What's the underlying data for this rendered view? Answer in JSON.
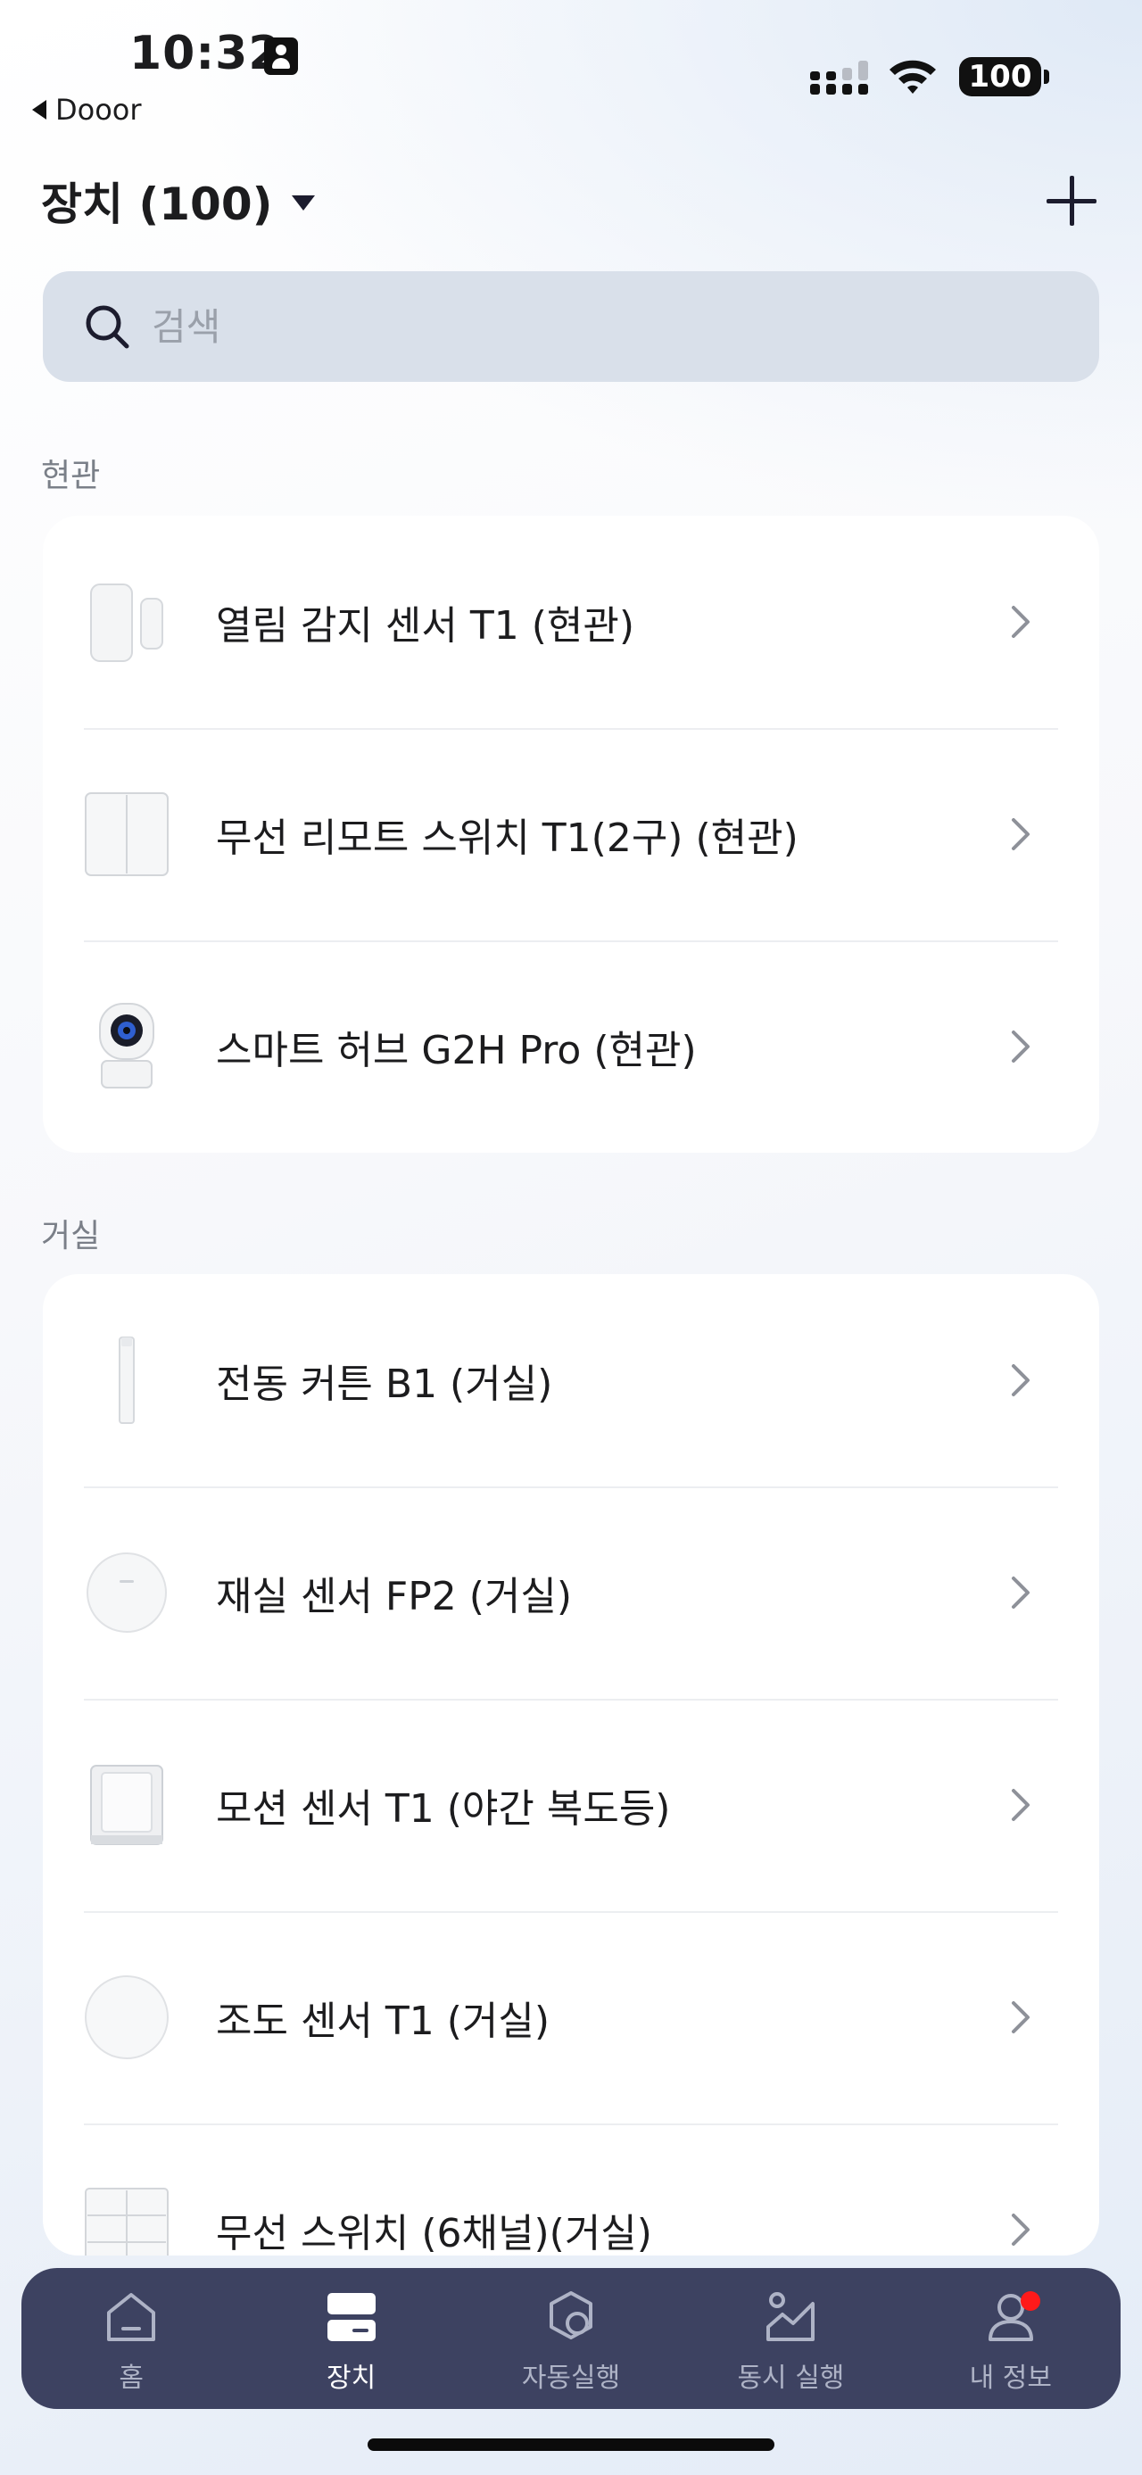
{
  "status_bar": {
    "time": "10:32",
    "back_app": "Dooor",
    "battery": "100"
  },
  "header": {
    "title": "장치 (100)"
  },
  "search": {
    "placeholder": "검색"
  },
  "sections": [
    {
      "label": "현관",
      "items": [
        {
          "label": "열림 감지 센서 T1 (현관)",
          "icon": "door-sensor-icon"
        },
        {
          "label": "무선 리모트 스위치 T1(2구) (현관)",
          "icon": "wall-switch-icon"
        },
        {
          "label": "스마트 허브 G2H Pro (현관)",
          "icon": "camera-hub-icon"
        }
      ]
    },
    {
      "label": "거실",
      "items": [
        {
          "label": "전동 커튼 B1 (거실)",
          "icon": "curtain-motor-icon"
        },
        {
          "label": "재실 센서 FP2 (거실)",
          "icon": "presence-sensor-icon"
        },
        {
          "label": "모션 센서 T1 (야간 복도등)",
          "icon": "motion-sensor-icon"
        },
        {
          "label": "조도 센서 T1 (거실)",
          "icon": "light-sensor-icon"
        },
        {
          "label": "무선 스위치 (6채널)(거실)",
          "icon": "six-gang-switch-icon"
        }
      ]
    }
  ],
  "tabs": [
    {
      "label": "홈",
      "icon": "home-icon",
      "active": false
    },
    {
      "label": "장치",
      "icon": "devices-icon",
      "active": true
    },
    {
      "label": "자동실행",
      "icon": "automation-icon",
      "active": false
    },
    {
      "label": "동시 실행",
      "icon": "scene-icon",
      "active": false
    },
    {
      "label": "내 정보",
      "icon": "profile-icon",
      "active": false,
      "badge": true
    }
  ],
  "colors": {
    "tab_bar": "#3d4261",
    "badge": "#ff1a1a",
    "search_bg": "#d9e0ea"
  }
}
